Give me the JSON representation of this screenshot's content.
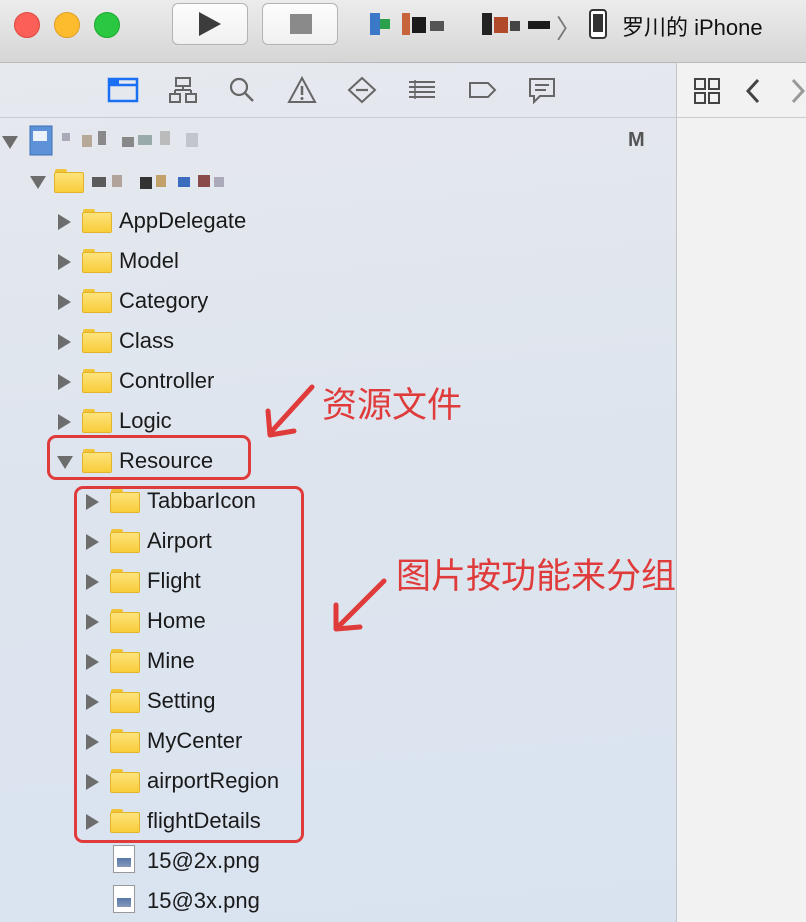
{
  "toolbar": {
    "device_name": "罗川的 iPhone",
    "play_icon": "play-icon",
    "stop_icon": "stop-icon",
    "breadcrumb_separator": "〉"
  },
  "navigator": {
    "tabs": [
      "folder-icon",
      "hierarchy-icon",
      "search-icon",
      "warning-icon",
      "diamond-icon",
      "list-icon",
      "tag-icon",
      "chat-icon"
    ],
    "project_status": "M",
    "items": [
      {
        "label": "AppDelegate"
      },
      {
        "label": "Model"
      },
      {
        "label": "Category"
      },
      {
        "label": "Class"
      },
      {
        "label": "Controller"
      },
      {
        "label": "Logic"
      },
      {
        "label": "Resource"
      }
    ],
    "resource_children": [
      {
        "label": "TabbarIcon"
      },
      {
        "label": "Airport"
      },
      {
        "label": "Flight"
      },
      {
        "label": "Home"
      },
      {
        "label": "Mine"
      },
      {
        "label": "Setting"
      },
      {
        "label": "MyCenter"
      },
      {
        "label": "airportRegion"
      },
      {
        "label": "flightDetails"
      }
    ],
    "files": [
      {
        "label": "15@2x.png"
      },
      {
        "label": "15@3x.png"
      }
    ]
  },
  "annotations": {
    "resource_note": "资源文件",
    "group_note": "图片按功能来分组"
  },
  "colors": {
    "accent": "#e03b3b",
    "folder": "#f8cd39",
    "selected_tab": "#1b6ff2"
  }
}
